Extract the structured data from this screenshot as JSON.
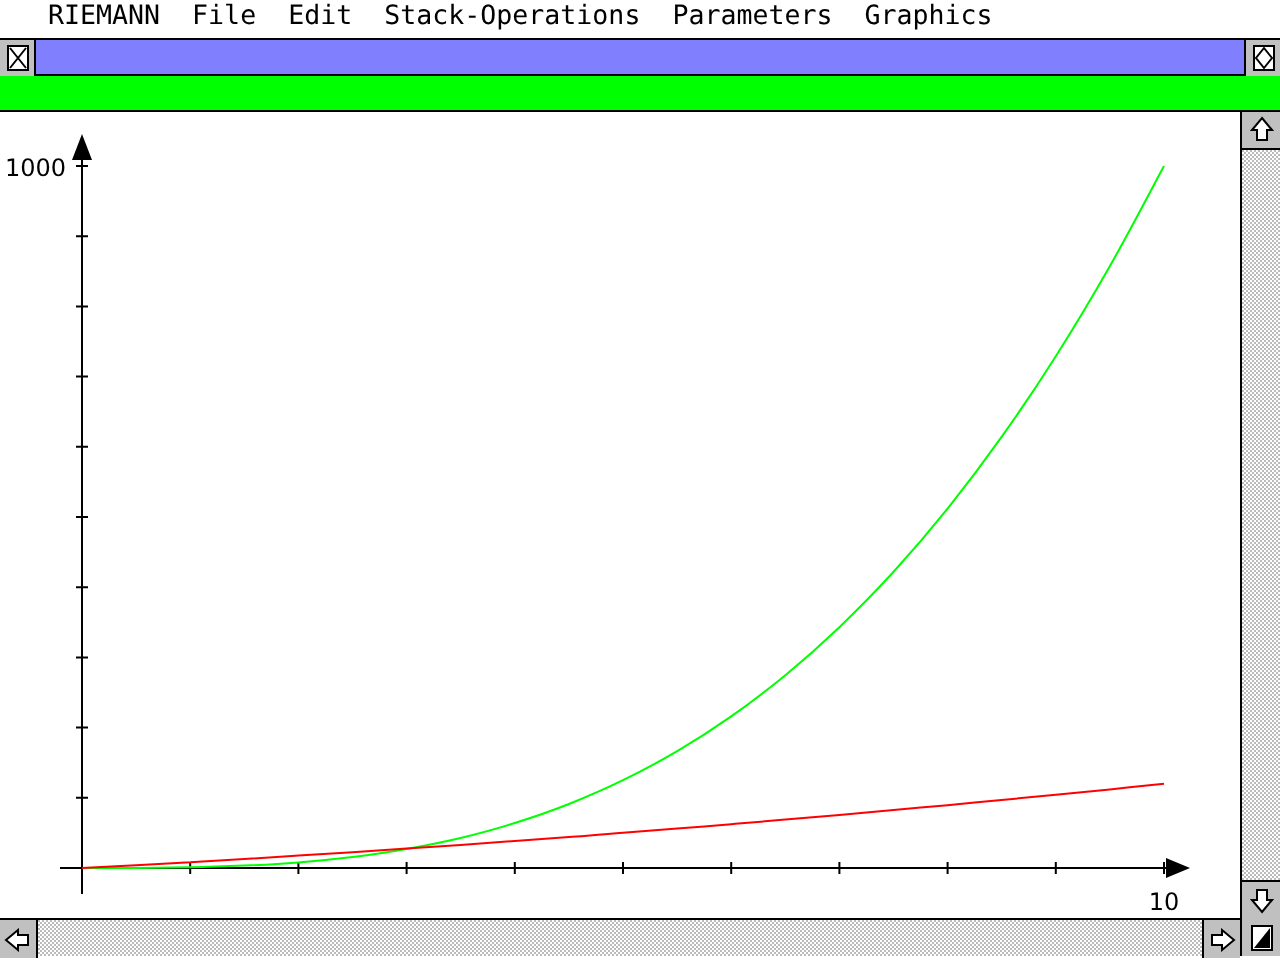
{
  "menu_bar": [
    {
      "label": "RIEMANN"
    },
    {
      "label": "File"
    },
    {
      "label": "Edit"
    },
    {
      "label": "Stack-Operations"
    },
    {
      "label": "Parameters"
    },
    {
      "label": "Graphics"
    }
  ],
  "graph": {
    "y_axis_label": "1000",
    "x_axis_label": "10",
    "curves": [
      {
        "color": "#00ff00"
      },
      {
        "color": "#ff0000"
      }
    ]
  }
}
